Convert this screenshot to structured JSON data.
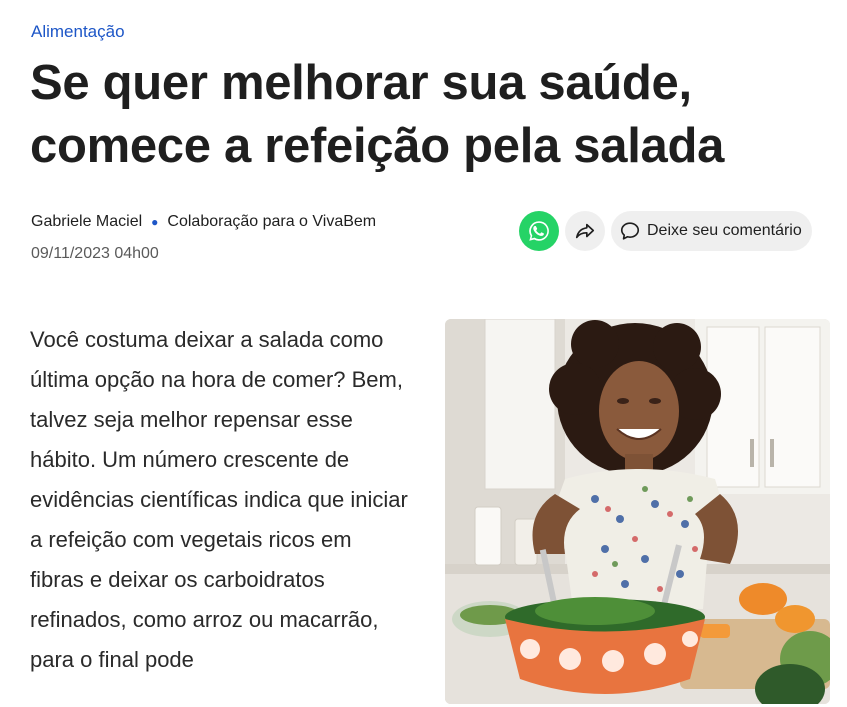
{
  "article": {
    "category": "Alimentação",
    "title": "Se quer melhorar sua saúde, comece a refeição pela salada",
    "author": "Gabriele Maciel",
    "collaboration": "Colaboração para o VivaBem",
    "date": "09/11/2023 04h00",
    "body": "Você costuma deixar a salada como última opção na hora de comer? Bem, talvez seja melhor repensar esse hábito. Um número crescente de evidências científicas indica que iniciar a refeição com vegetais ricos em fibras e deixar os carboidratos refinados, como arroz ou macarrão, para o final pode"
  },
  "actions": {
    "comment_label": "Deixe seu comentário",
    "whatsapp_icon": "whatsapp-icon",
    "share_icon": "share-arrow-icon",
    "comment_icon": "speech-bubble-icon"
  },
  "colors": {
    "accent": "#1d56c7",
    "whatsapp": "#25d366",
    "button_bg": "#efefef"
  }
}
